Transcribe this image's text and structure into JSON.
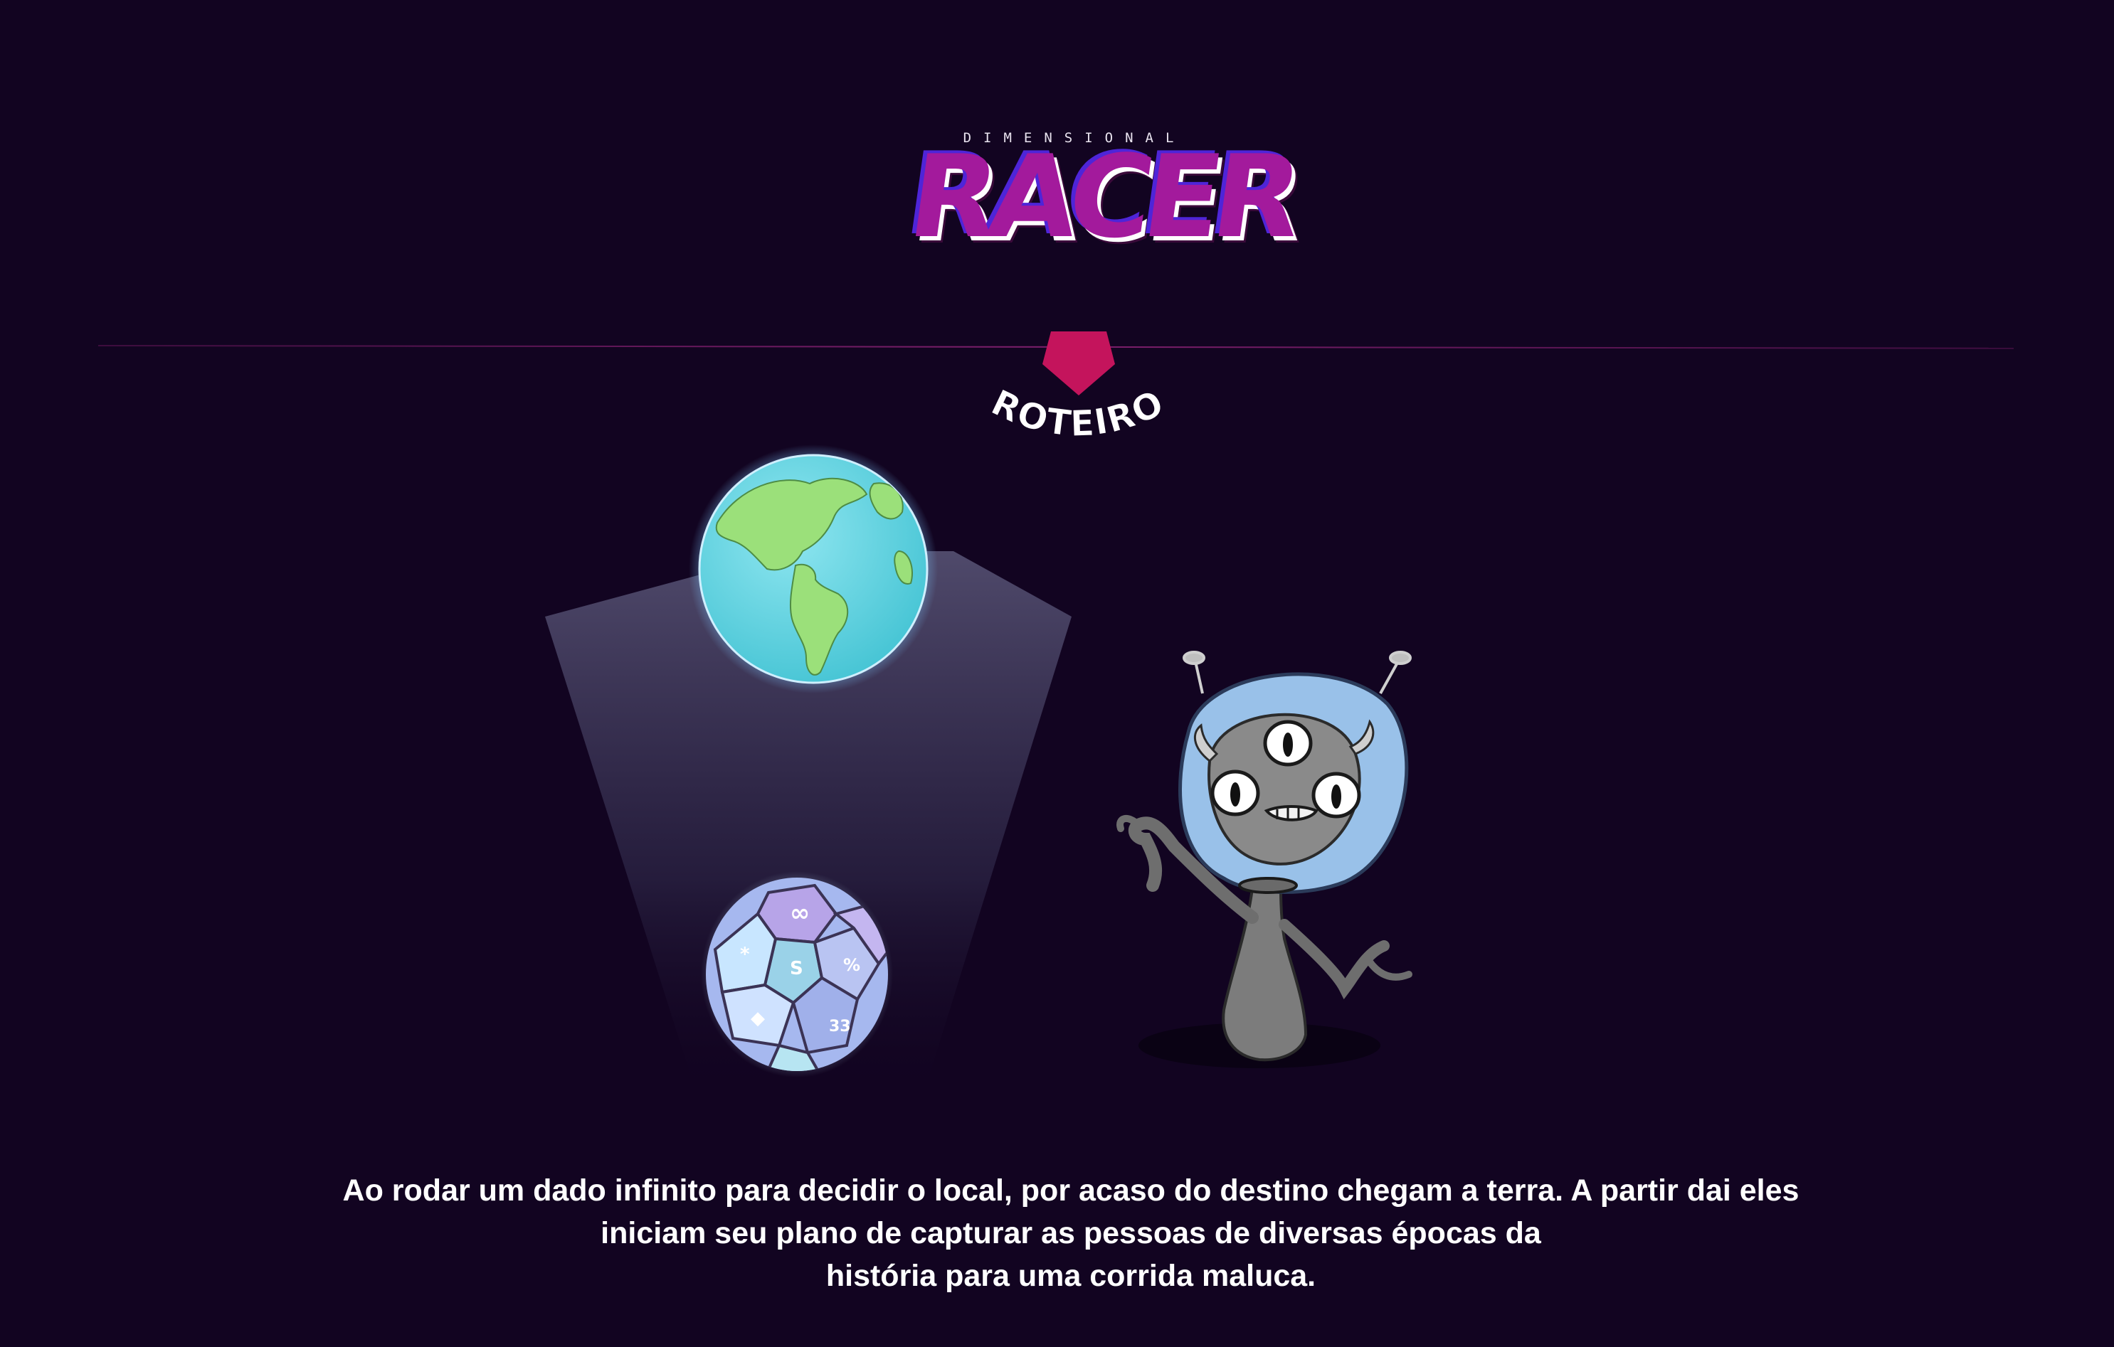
{
  "header": {
    "logo_subtitle": "DIMENSIONAL",
    "logo_title": "RACER"
  },
  "section": {
    "title": "ROTEIRO"
  },
  "scene": {
    "earth_label": "earth-globe",
    "dice_label": "infinite-dice",
    "character_label": "alien-character"
  },
  "caption": {
    "line1": "Ao rodar um dado infinito para decidir o local, por acaso do destino chegam a terra. A partir dai eles",
    "line2": "iniciam seu plano de capturar as pessoas de diversas épocas da",
    "line3": "história para uma corrida maluca."
  },
  "colors": {
    "background": "#120421",
    "accent": "#c4145c",
    "logo_purple": "#a31a9c",
    "logo_blue": "#4e25d8",
    "divider": "#7e1f6d"
  }
}
